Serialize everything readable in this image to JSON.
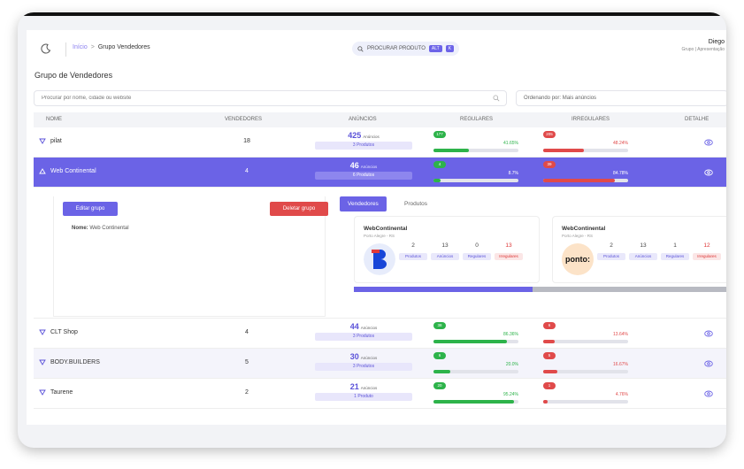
{
  "topbar": {
    "breadcrumb_home": "Início",
    "breadcrumb_sep": ">",
    "breadcrumb_current": "Grupo Vendedores",
    "search_label": "PROCURAR PRODUTO",
    "search_kbd1": "ALT",
    "search_kbd2": "K",
    "user_name": "Diego",
    "user_role": "Grupo | Apresentação"
  },
  "page": {
    "title": "Grupo de Vendedores",
    "search_placeholder": "Procurar por nome, cidade ou website",
    "order_label": "Ordenando por: Mais anúncios"
  },
  "table": {
    "headers": [
      "NOME",
      "VENDEDORES",
      "ANÚNCIOS",
      "REGULARES",
      "IRREGULARES",
      "DETALHE"
    ],
    "rows": [
      {
        "name": "pilat",
        "vendors": "18",
        "ads": "425",
        "ads_label": "Anúncios",
        "products": "3 Produtos",
        "reg_badge": "177",
        "reg_pct": "41.65%",
        "reg_val": 0.4165,
        "irr_badge": "205",
        "irr_pct": "48.24%",
        "irr_val": 0.4824
      },
      {
        "name": "Web Continental",
        "vendors": "4",
        "ads": "46",
        "ads_label": "Anúncios",
        "products": "6 Produtos",
        "reg_badge": "4",
        "reg_pct": "8.7%",
        "reg_val": 0.087,
        "irr_badge": "39",
        "irr_pct": "84.78%",
        "irr_val": 0.8478
      },
      {
        "name": "CLT Shop",
        "vendors": "4",
        "ads": "44",
        "ads_label": "Anúncios",
        "products": "3 Produtos",
        "reg_badge": "38",
        "reg_pct": "86.36%",
        "reg_val": 0.8636,
        "irr_badge": "6",
        "irr_pct": "13.64%",
        "irr_val": 0.1364
      },
      {
        "name": "BODY.BUILDERS",
        "vendors": "5",
        "ads": "30",
        "ads_label": "Anúncios",
        "products": "3 Produtos",
        "reg_badge": "6",
        "reg_pct": "20.0%",
        "reg_val": 0.2,
        "irr_badge": "5",
        "irr_pct": "16.67%",
        "irr_val": 0.1667
      },
      {
        "name": "Taurene",
        "vendors": "2",
        "ads": "21",
        "ads_label": "Anúncios",
        "products": "1 Produto",
        "reg_badge": "20",
        "reg_pct": "95.24%",
        "reg_val": 0.9524,
        "irr_badge": "1",
        "irr_pct": "4.76%",
        "irr_val": 0.0476
      }
    ]
  },
  "detail": {
    "edit_label": "Editar grupo",
    "delete_label": "Deletar grupo",
    "name_label": "Nome:",
    "name_value": "Web Continental",
    "tab_vendors": "Vendedores",
    "tab_products": "Produtos",
    "scroll_pos": 0.48,
    "cards": [
      {
        "name": "WebContinental",
        "city": "Porto Alegre - RS",
        "logo": "b-logo",
        "stats": [
          {
            "v": "2",
            "l": "Produtos"
          },
          {
            "v": "13",
            "l": "Anúncios"
          },
          {
            "v": "0",
            "l": "Regulares"
          },
          {
            "v": "13",
            "l": "Irregulares",
            "red": true
          }
        ]
      },
      {
        "name": "WebContinental",
        "city": "Porto Alegre - RS",
        "logo": "ponto-logo",
        "logo_text": "ponto:",
        "stats": [
          {
            "v": "2",
            "l": "Produtos"
          },
          {
            "v": "13",
            "l": "Anúncios"
          },
          {
            "v": "1",
            "l": "Regulares"
          },
          {
            "v": "12",
            "l": "Irregulares",
            "red": true
          }
        ]
      }
    ]
  },
  "colors": {
    "accent": "#6b63e6",
    "green": "#2db34a",
    "red": "#e04a4a"
  }
}
